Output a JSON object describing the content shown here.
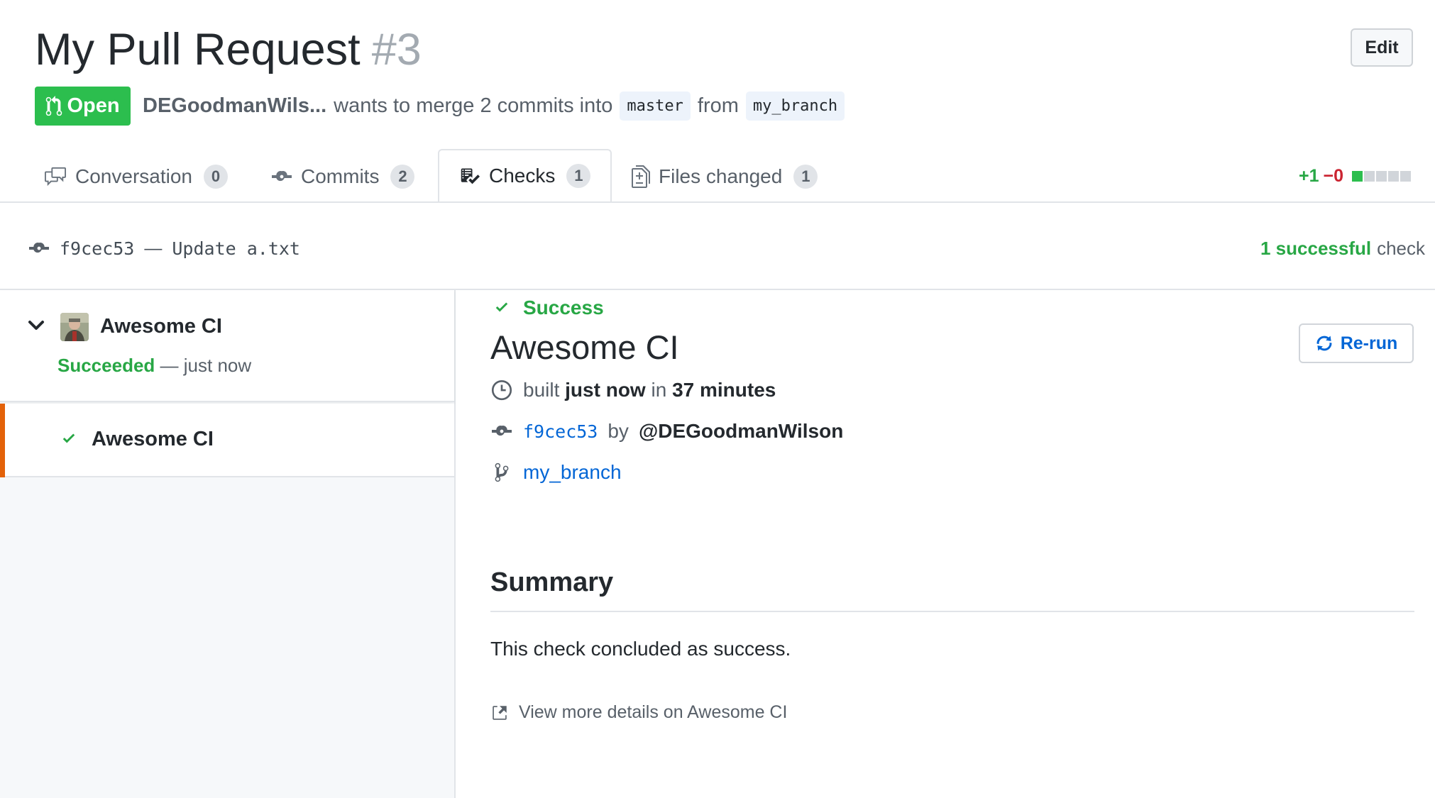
{
  "pr": {
    "title": "My Pull Request",
    "number": "#3",
    "edit_label": "Edit",
    "state_label": "Open",
    "author": "DEGoodmanWils...",
    "merge_text": "wants to merge 2 commits into",
    "base_branch": "master",
    "from_text": "from",
    "head_branch": "my_branch"
  },
  "tabs": [
    {
      "label": "Conversation",
      "count": "0"
    },
    {
      "label": "Commits",
      "count": "2"
    },
    {
      "label": "Checks",
      "count": "1"
    },
    {
      "label": "Files changed",
      "count": "1"
    }
  ],
  "diffstat": {
    "additions": "+1",
    "deletions": "−0",
    "blocks": [
      "green",
      "gray",
      "gray",
      "gray",
      "gray"
    ]
  },
  "commit": {
    "sha": "f9cec53",
    "separator": "—",
    "message": "Update a.txt"
  },
  "check_summary": {
    "count_text": "1 successful",
    "suffix": "check"
  },
  "suite": {
    "app_name": "Awesome CI",
    "status": "Succeeded",
    "status_suffix": "— just now",
    "runs": [
      {
        "name": "Awesome CI"
      }
    ]
  },
  "detail": {
    "title": "Awesome CI",
    "rerun_label": "Re-run",
    "result": "Success",
    "built_prefix": "built",
    "built_when": "just now",
    "built_mid": "in",
    "built_duration": "37 minutes",
    "commit_sha": "f9cec53",
    "by_text": "by",
    "author": "@DEGoodmanWilson",
    "branch": "my_branch",
    "summary_heading": "Summary",
    "summary_text": "This check concluded as success.",
    "details_link": "View more details on Awesome CI"
  },
  "colors": {
    "success": "#28a745",
    "accent_run": "#e36209",
    "link": "#0366d6",
    "open_badge": "#2cbe4e"
  }
}
